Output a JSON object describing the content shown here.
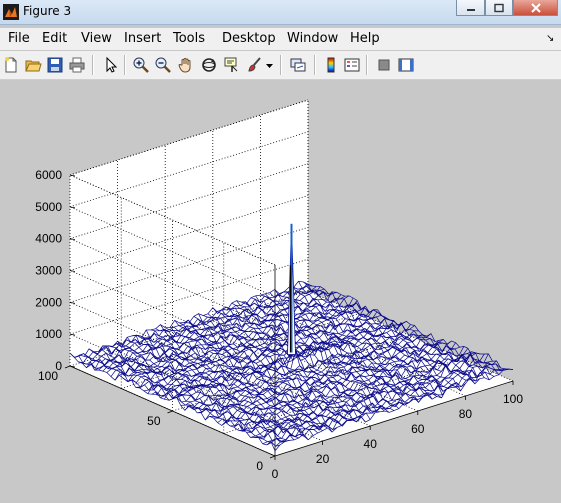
{
  "window": {
    "title": "Figure 3",
    "buttons": [
      "minimize",
      "maximize",
      "close"
    ]
  },
  "menubar": {
    "items": [
      "File",
      "Edit",
      "View",
      "Insert",
      "Tools",
      "Desktop",
      "Window",
      "Help"
    ],
    "dock_glyph": "↘"
  },
  "toolbar": {
    "icons": [
      "new-figure-icon",
      "open-file-icon",
      "save-icon",
      "print-icon",
      "edit-plot-pointer-icon",
      "zoom-in-icon",
      "zoom-out-icon",
      "pan-hand-icon",
      "rotate-3d-icon",
      "data-cursor-icon",
      "brush-icon",
      "link-plot-icon",
      "colorbar-icon",
      "legend-icon",
      "hide-plot-tools-icon",
      "show-plot-tools-icon"
    ]
  },
  "chart_data": {
    "type": "mesh-3d",
    "z_ticks": [
      "0",
      "1000",
      "2000",
      "3000",
      "4000",
      "5000",
      "6000"
    ],
    "x_ticks": [
      "0",
      "20",
      "40",
      "60",
      "80",
      "100"
    ],
    "y_ticks": [
      "0",
      "50",
      "100"
    ],
    "zlim": [
      0,
      6000
    ],
    "xlim": [
      0,
      100
    ],
    "ylim": [
      0,
      100
    ],
    "grid": true,
    "peak": {
      "x": 50,
      "y": 50,
      "z": 4700
    },
    "secondary_peak": {
      "x": 50,
      "y": 50,
      "z": 3400
    },
    "surface_color": "#0b0b8c",
    "peak_color": "#1a5fd1"
  }
}
